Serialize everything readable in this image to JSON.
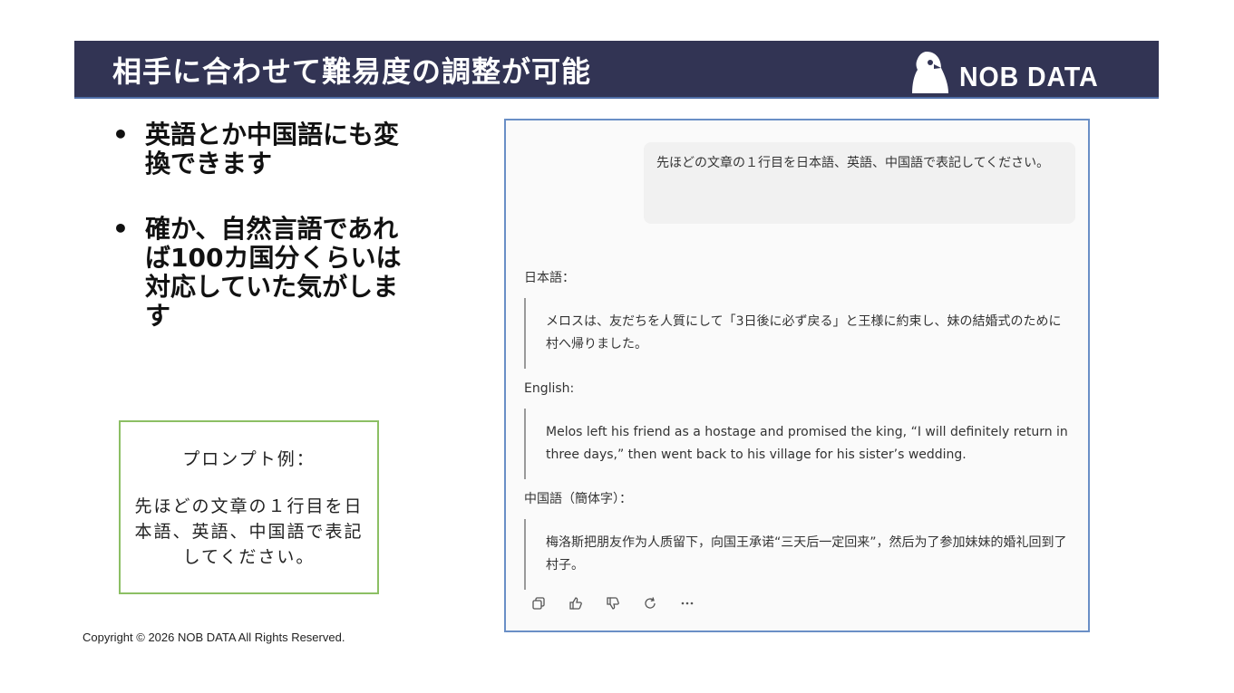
{
  "header": {
    "title": "相手に合わせて難易度の調整が可能",
    "brand": "NOB DATA",
    "brand_icon": "penguin-logo-icon"
  },
  "bullets": [
    {
      "text": "英語とか中国語にも変換できます"
    },
    {
      "text": "確か、自然言語であれば100カ国分くらいは対応していた気がします"
    }
  ],
  "prompt_box": {
    "label": "プロンプト例：",
    "text": "先ほどの文章の１行目を日本語、英語、中国語で表記してください。"
  },
  "footer": {
    "copyright": "Copyright © 2026 NOB DATA All Rights Reserved."
  },
  "chat": {
    "user_message": "先ほどの文章の１行目を日本語、英語、中国語で表記してください。",
    "replies": [
      {
        "label": "日本語：",
        "text": "メロスは、友だちを人質にして「3日後に必ず戻る」と王様に約束し、妹の結婚式のために村へ帰りました。"
      },
      {
        "label": "English:",
        "text": "Melos left his friend as a hostage and promised the king, “I will definitely return in three days,” then went back to his village for his sister’s wedding."
      },
      {
        "label": "中国語（簡体字）：",
        "text": "梅洛斯把朋友作为人质留下，向国王承诺“三天后一定回来”，然后为了参加妹妹的婚礼回到了村子。"
      }
    ],
    "actions": [
      "copy-icon",
      "thumbs-up-icon",
      "thumbs-down-icon",
      "regenerate-icon",
      "more-icon"
    ]
  },
  "colors": {
    "header_bg": "#323454",
    "prompt_border": "#8cbf64",
    "chat_border": "#6a8fc6"
  }
}
